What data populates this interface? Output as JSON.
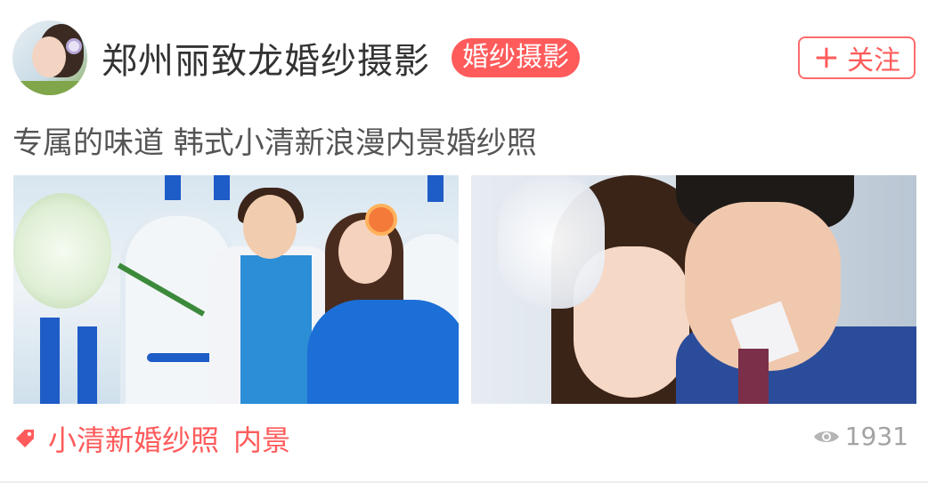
{
  "header": {
    "shop_name": "郑州丽致龙婚纱摄影",
    "category_badge": "婚纱摄影",
    "follow_button": {
      "icon": "plus-icon",
      "label": "关注"
    }
  },
  "subtitle": "专属的味道 韩式小清新浪漫内景婚纱照",
  "photos": [
    {
      "icon": "photo-couple-blue-set"
    },
    {
      "icon": "photo-couple-closeup"
    }
  ],
  "tags": {
    "icon": "tag-icon",
    "items": [
      "小清新婚纱照",
      "内景"
    ]
  },
  "views": {
    "icon": "eye-icon",
    "count": "1931"
  },
  "colors": {
    "accent": "#ff5b5b",
    "text_primary": "#333333",
    "text_secondary": "#555555",
    "muted": "#a3a3a3"
  }
}
